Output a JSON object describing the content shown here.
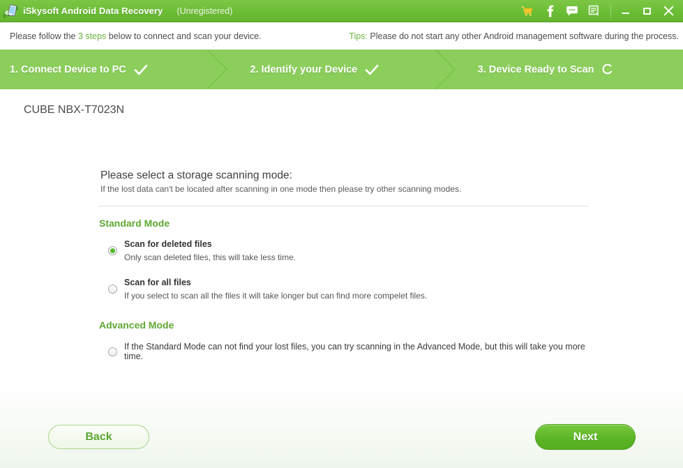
{
  "titlebar": {
    "app_name": "iSkysoft Android Data Recovery",
    "registration": "(Unregistered)",
    "logo_icon": "app-logo-icon",
    "icons": [
      {
        "name": "shopping-cart-icon",
        "label": "Buy"
      },
      {
        "name": "facebook-icon",
        "label": "f"
      },
      {
        "name": "chat-bubble-icon",
        "label": "Support"
      },
      {
        "name": "feedback-icon",
        "label": "Feedback"
      }
    ],
    "window_controls": [
      {
        "name": "minimize-button",
        "label": "Minimize"
      },
      {
        "name": "maximize-button",
        "label": "Maximize"
      },
      {
        "name": "close-button",
        "label": "Close"
      }
    ],
    "bar_color": "#6cbd36"
  },
  "infobar": {
    "left_prefix": "Please follow the ",
    "left_highlight": "3 steps",
    "left_suffix": " below to connect and scan your device.",
    "tips_label": "Tips:",
    "tips_text": " Please do not start any other Android management software during the process.",
    "highlight_color": "#6cb33f"
  },
  "steps": {
    "bar_color": "#8bce5b",
    "items": [
      {
        "label": "1. Connect Device to PC",
        "state": "done",
        "mark": "check-icon"
      },
      {
        "label": "2. Identify your Device",
        "state": "done",
        "mark": "check-icon"
      },
      {
        "label": "3. Device Ready to Scan",
        "state": "loading",
        "mark": "spinner-icon"
      }
    ]
  },
  "device": {
    "name": "CUBE NBX-T7023N"
  },
  "panel": {
    "title": "Please select a storage scanning mode:",
    "subtitle": "If the lost data can't be located after scanning in one mode then please try other scanning modes.",
    "standard_mode": {
      "heading": "Standard Mode",
      "heading_color": "#5fa832",
      "options": [
        {
          "title": "Scan for deleted files",
          "desc": "Only scan deleted files, this will take less time.",
          "selected": true
        },
        {
          "title": "Scan for all files",
          "desc": "If you select to scan all the files it will take longer but can find more compelet files.",
          "selected": false
        }
      ]
    },
    "advanced_mode": {
      "heading": "Advanced Mode",
      "heading_color": "#5fa832",
      "options": [
        {
          "text": "If the Standard Mode can not find your lost files, you can try scanning in the Advanced Mode, but this will take you more time.",
          "selected": false
        }
      ]
    }
  },
  "footer": {
    "back_label": "Back",
    "next_label": "Next",
    "next_color": "#5cb524"
  }
}
